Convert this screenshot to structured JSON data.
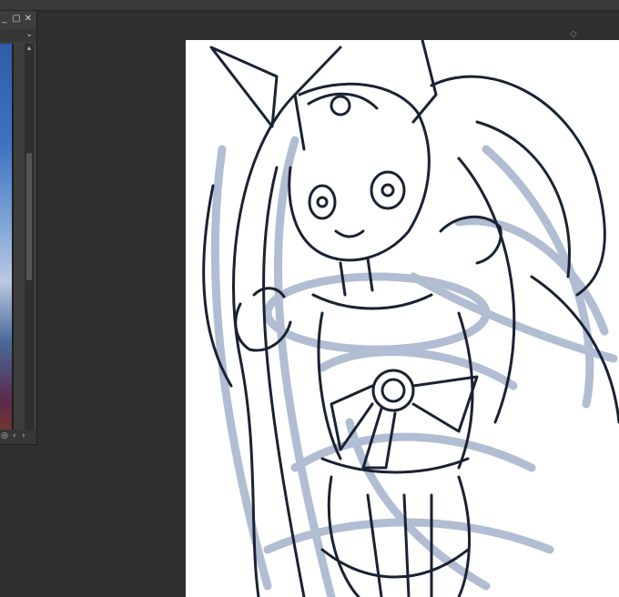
{
  "window": {
    "min_icon": "minimize-icon",
    "max_icon": "maximize-icon",
    "close_icon": "close-icon",
    "min_glyph": "_",
    "max_glyph": "▢",
    "close_glyph": "✕"
  },
  "subwindow": {
    "dropdown_glyph": "⌄",
    "scroll_up_glyph": "▴",
    "scroll_down_glyph": "▾",
    "nav_glyphs": [
      "◎",
      "‹",
      "›"
    ]
  },
  "canvas": {
    "background": "#ffffff",
    "line_color": "#1a2233",
    "sketch_color": "#a9b6cf",
    "handle_glyph": "◇"
  },
  "colors": {
    "workspace": "#2f2f2f",
    "panel": "#3d3d3d"
  }
}
